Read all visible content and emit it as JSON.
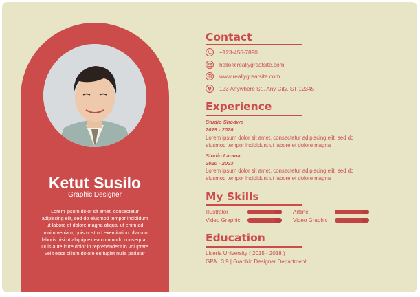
{
  "profile": {
    "name": "Ketut Susilo",
    "role": "Graphic Designer",
    "bio": "Lorem ipsum dolor sit amet, consectetur adipiscing elit, sed do eiusmod tempor incididunt ut labore et dolore magna aliqua. ut enim ad minim veniam, quis nostrud exercitation ullamco laboris nisi ut aliquip ex ea commodo consequat. Duis aute irure dolor in reprehenderit in voluptate velit esse cillum dolore eu fugiat nulla pariatur"
  },
  "contact": {
    "title": "Contact",
    "items": [
      {
        "icon": "phone-icon",
        "text": "+123-456-7890"
      },
      {
        "icon": "email-icon",
        "text": "hello@reallygreatsite.com"
      },
      {
        "icon": "globe-icon",
        "text": "www.reallygreatsite.com"
      },
      {
        "icon": "location-icon",
        "text": "123 Anywhere St., Any City, ST 12345"
      }
    ]
  },
  "experience": {
    "title": "Experience",
    "jobs": [
      {
        "company": "Studio Shodwe",
        "dates": "2019 - 2020",
        "desc": "Lorem ipsum dolor sit amet, consectetur adipiscing elit, sed do eiusmod tempor incididunt ut labore et dolore magna"
      },
      {
        "company": "Studio Larana",
        "dates": "2020 - 2023",
        "desc": "Lorem ipsum dolor sit amet, consectetur adipiscing elit, sed do eiusmod tempor incididunt ut labore et dolore magna"
      }
    ]
  },
  "skills": {
    "title": "My Skills",
    "items": [
      {
        "label": "Illustrator",
        "level": 0.8
      },
      {
        "label": "Video Graphic",
        "level": 0.8
      },
      {
        "label": "Artline",
        "level": 0.8
      },
      {
        "label": "Video Graphic",
        "level": 0.8
      }
    ]
  },
  "education": {
    "title": "Education",
    "school": "Licerla University ( 2015 - 2018 )",
    "detail": "GPA : 3,9 | Graphic Designer Department"
  },
  "colors": {
    "accent": "#cc4b4b",
    "background": "#e8e4c6"
  }
}
